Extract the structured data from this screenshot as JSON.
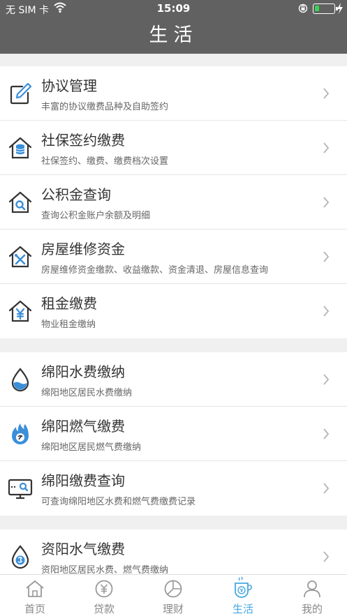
{
  "status_bar": {
    "carrier": "无 SIM 卡",
    "time": "15:09"
  },
  "header": {
    "title": "生活"
  },
  "groups": [
    {
      "items": [
        {
          "title": "协议管理",
          "desc": "丰富的协议缴费品种及自助签约",
          "icon": "edit-icon"
        },
        {
          "title": "社保签约缴费",
          "desc": "社保签约、缴费、缴费档次设置",
          "icon": "house-coins-icon"
        },
        {
          "title": "公积金查询",
          "desc": "查询公积金账户余额及明细",
          "icon": "house-search-icon"
        },
        {
          "title": "房屋维修资金",
          "desc": "房屋维修资金缴款、收益缴款、资金清退、房屋信息查询",
          "icon": "house-tools-icon"
        },
        {
          "title": "租金缴费",
          "desc": "物业租金缴纳",
          "icon": "house-yen-icon"
        }
      ]
    },
    {
      "items": [
        {
          "title": "绵阳水费缴纳",
          "desc": "绵阳地区居民水费缴纳",
          "icon": "water-drop-icon"
        },
        {
          "title": "绵阳燃气缴费",
          "desc": "绵阳地区居民燃气费缴纳",
          "icon": "flame-icon"
        },
        {
          "title": "绵阳缴费查询",
          "desc": "可查询绵阳地区水费和燃气费缴费记录",
          "icon": "monitor-search-icon"
        }
      ]
    },
    {
      "items": [
        {
          "title": "资阳水气缴费",
          "desc": "资阳地区居民水费、燃气费缴纳",
          "icon": "water-gas-icon"
        }
      ]
    }
  ],
  "tabbar": {
    "tabs": [
      {
        "label": "首页",
        "icon": "home-icon"
      },
      {
        "label": "贷款",
        "icon": "loan-icon"
      },
      {
        "label": "理财",
        "icon": "finance-icon"
      },
      {
        "label": "生活",
        "icon": "life-cup-icon",
        "active": true
      },
      {
        "label": "我的",
        "icon": "user-icon"
      }
    ]
  },
  "colors": {
    "header": "#616161",
    "accent": "#46a8e0",
    "icon_blue": "#3b8fd9"
  }
}
